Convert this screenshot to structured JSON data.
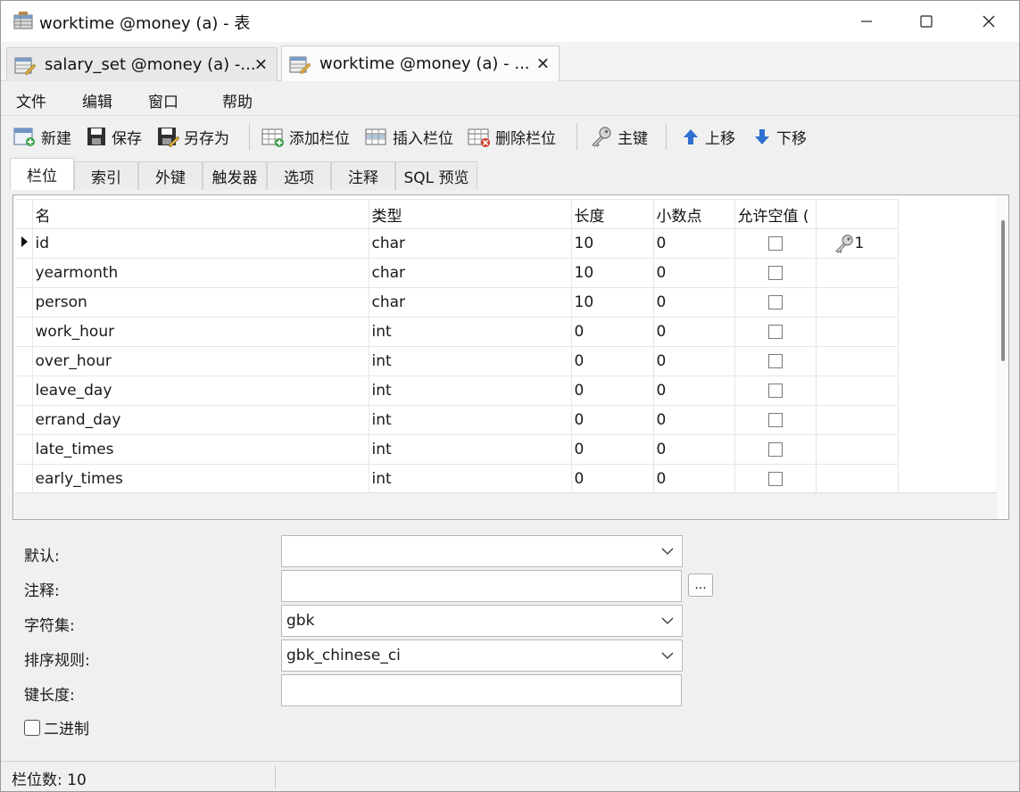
{
  "window": {
    "title": "worktime @money (a) - 表",
    "min_symbol": "—",
    "max_symbol": "☐",
    "close_symbol": "✕"
  },
  "doc_tabs": [
    {
      "label": "salary_set @money (a) -...",
      "close": "✕",
      "active": false
    },
    {
      "label": "worktime @money (a) - ...",
      "close": "✕",
      "active": true
    }
  ],
  "menu": [
    "文件",
    "编辑",
    "窗口",
    "帮助"
  ],
  "toolbar": {
    "new": "新建",
    "save": "保存",
    "save_as": "另存为",
    "add_column": "添加栏位",
    "insert_column": "插入栏位",
    "delete_column": "删除栏位",
    "primary_key": "主键",
    "move_up": "上移",
    "move_down": "下移"
  },
  "sub_tabs": [
    "栏位",
    "索引",
    "外键",
    "触发器",
    "选项",
    "注释",
    "SQL 预览"
  ],
  "columns_table": {
    "headers": [
      "名",
      "类型",
      "长度",
      "小数点",
      "允许空值 (",
      ""
    ],
    "rows": [
      {
        "name": "id",
        "type": "char",
        "length": "10",
        "decimals": "0",
        "nullable": false,
        "key": "1",
        "current": true
      },
      {
        "name": "yearmonth",
        "type": "char",
        "length": "10",
        "decimals": "0",
        "nullable": false,
        "key": "",
        "current": false
      },
      {
        "name": "person",
        "type": "char",
        "length": "10",
        "decimals": "0",
        "nullable": false,
        "key": "",
        "current": false
      },
      {
        "name": "work_hour",
        "type": "int",
        "length": "0",
        "decimals": "0",
        "nullable": false,
        "key": "",
        "current": false
      },
      {
        "name": "over_hour",
        "type": "int",
        "length": "0",
        "decimals": "0",
        "nullable": false,
        "key": "",
        "current": false
      },
      {
        "name": "leave_day",
        "type": "int",
        "length": "0",
        "decimals": "0",
        "nullable": false,
        "key": "",
        "current": false
      },
      {
        "name": "errand_day",
        "type": "int",
        "length": "0",
        "decimals": "0",
        "nullable": false,
        "key": "",
        "current": false
      },
      {
        "name": "late_times",
        "type": "int",
        "length": "0",
        "decimals": "0",
        "nullable": false,
        "key": "",
        "current": false
      },
      {
        "name": "early_times",
        "type": "int",
        "length": "0",
        "decimals": "0",
        "nullable": false,
        "key": "",
        "current": false
      }
    ]
  },
  "properties": {
    "default_label": "默认:",
    "default_value": "",
    "comment_label": "注释:",
    "comment_value": "",
    "comment_button": "...",
    "charset_label": "字符集:",
    "charset_value": "gbk",
    "collation_label": "排序规则:",
    "collation_value": "gbk_chinese_ci",
    "key_length_label": "键长度:",
    "key_length_value": "",
    "binary_label": "二进制",
    "binary_checked": false
  },
  "status": {
    "text": "栏位数: 10"
  }
}
